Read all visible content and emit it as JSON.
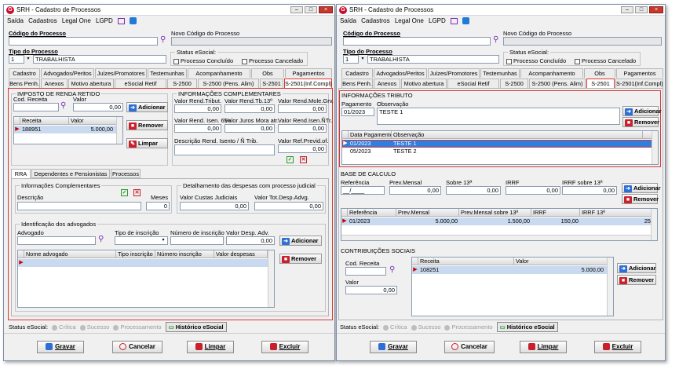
{
  "left": {
    "title": "SRH - Cadastro de Processos",
    "menu": [
      "Saída",
      "Cadastros",
      "Legal One",
      "LGPD"
    ],
    "codigo_label": "Código do Processo",
    "novo_codigo_label": "Novo Código do Processo",
    "tipo_label": "Tipo do Processo",
    "tipo_code": "1",
    "tipo_name": "TRABALHISTA",
    "status_label": "Status eSocial:",
    "status_concluido": "Processo Concluído",
    "status_cancelado": "Processo Cancelado",
    "tabs_row1": [
      "Cadastro",
      "Advogados/Peritos",
      "Juízes/Promotores",
      "Testemunhas",
      "Acompanhamento",
      "Obs",
      "Pagamentos"
    ],
    "tabs_row2": [
      "Bens Penh.",
      "Anexos",
      "Motivo abertura",
      "eSocial Retif",
      "S-2500",
      "S-2500 (Pens. Alim)",
      "S-2501",
      "S-2501(Inf.Compl)"
    ],
    "ir": {
      "title": "IMPOSTO DE RENDA RETIDO",
      "cod_receita": "Cod. Receita",
      "valor": "Valor",
      "valor_val": "0,00",
      "grid_cols": [
        "Receita",
        "Valor"
      ],
      "rows": [
        {
          "receita": "188951",
          "valor": "5.000,00"
        }
      ]
    },
    "buttons": {
      "adicionar": "Adicionar",
      "remover": "Remover",
      "limpar": "Limpar"
    },
    "info": {
      "title": "INFORMAÇÕES COMPLEMENTARES",
      "fields": [
        "Valor Rend.Tribut.",
        "Valor Rend.Tb.13º",
        "Valor Rend.Mole.Grv.",
        "Valor Rend. Isen. 65+",
        "Valor Juros Mora atr.",
        "Valor Rend.Isen.ÑTr.",
        "Descrição Rend. Isento / Ñ Trib.",
        "Valor Ref.Previd.of."
      ],
      "zeros": [
        "0,00",
        "0,00",
        "0,00",
        "0,00",
        "0,00",
        "0,00",
        "0,00"
      ]
    },
    "subtabs": [
      "RRA",
      "Dependentes e Pensionistas",
      "Processos"
    ],
    "ic": {
      "title": "Informações Complementares",
      "descricao": "Descrição",
      "meses": "Meses",
      "meses_val": "0"
    },
    "dd": {
      "title": "Detalhamento das despesas com processo judicial",
      "custas": "Valor Custas Judiciais",
      "custas_val": "0,00",
      "tot": "Valor Tot.Desp.Advg.",
      "tot_val": "0,00"
    },
    "adv": {
      "title": "Identificação dos advogados",
      "advogado": "Advogado",
      "tipo": "Tipo de inscrição",
      "numero": "Número de inscrição",
      "valor": "Valor Desp. Adv.",
      "valor_val": "0,00",
      "cols": [
        "Nome advogado",
        "Tipo inscrição",
        "Número inscrição",
        "Valor despesas"
      ]
    },
    "st": [
      "Crítica",
      "Sucesso",
      "Processamento"
    ],
    "hist": "Histórico eSocial",
    "bottom": [
      "Gravar",
      "Cancelar",
      "Limpar",
      "Excluir"
    ]
  },
  "right": {
    "title": "SRH - Cadastro de Processos",
    "menu": [
      "Saída",
      "Cadastros",
      "Legal One",
      "LGPD"
    ],
    "codigo_label": "Código do Processo",
    "novo_codigo_label": "Novo Código do Processo",
    "tipo_label": "Tipo do Processo",
    "tipo_code": "1",
    "tipo_name": "TRABALHISTA",
    "status_label": "Status eSocial:",
    "status_concluido": "Processo Concluído",
    "status_cancelado": "Processo Cancelado",
    "tabs_row1": [
      "Cadastro",
      "Advogados/Peritos",
      "Juízes/Promotores",
      "Testemunhas",
      "Acompanhamento",
      "Obs",
      "Pagamentos"
    ],
    "tabs_row2": [
      "Bens Penh.",
      "Anexos",
      "Motivo abertura",
      "eSocial Retif",
      "S-2500",
      "S-2500 (Pens. Alim)",
      "S-2501",
      "S-2501(Inf.Compl)"
    ],
    "it": {
      "title": "INFORMAÇÕES TRIBUTO",
      "pagamento": "Pagamento",
      "pagamento_val": "01/2023",
      "observacao": "Observação",
      "obs_val": "TESTE 1",
      "cols": [
        "Data Pagamento",
        "Observação"
      ],
      "rows": [
        {
          "data": "01/2023",
          "obs": "TESTE 1"
        },
        {
          "data": "05/2023",
          "obs": "TESTE 2"
        }
      ]
    },
    "bc": {
      "title": "BASE DE CALCULO",
      "referencia": "Referência",
      "ref_val": "__/____",
      "prev": "Prev.Mensal",
      "prev_val": "0,00",
      "s13": "Sobre 13ª",
      "s13_val": "0,00",
      "irrf": "IRRF",
      "irrf_val": "0,00",
      "irrf13": "IRRF sobre 13ª",
      "irrf13_val": "0,00",
      "cols": [
        "Referência",
        "Prev.Mensal",
        "Prev.Mensal sobre 13ª",
        "IRRF",
        "IRRF 13ª"
      ],
      "rows": [
        {
          "ref": "01/2023",
          "prev": "5.000,00",
          "s13": "1.500,00",
          "irrf": "150,00",
          "irrf13": "25"
        }
      ]
    },
    "cs": {
      "title": "CONTRIBUIÇÕES SOCIAIS",
      "cod": "Cod. Receita",
      "valor": "Valor",
      "valor_val": "0,00",
      "cols": [
        "Receita",
        "Valor"
      ],
      "rows": [
        {
          "receita": "108251",
          "valor": "5.000,00"
        }
      ]
    },
    "buttons": {
      "adicionar": "Adicionar",
      "remover": "Remover"
    },
    "st": [
      "Crítica",
      "Sucesso",
      "Processamento"
    ],
    "hist": "Histórico eSocial",
    "bottom": [
      "Gravar",
      "Cancelar",
      "Limpar",
      "Excluir"
    ]
  },
  "colors": {
    "highlight": "#d8383a",
    "selection": "#2f7fe0",
    "accent_purple": "#7b2fb0",
    "brand_red": "#c8102e"
  }
}
